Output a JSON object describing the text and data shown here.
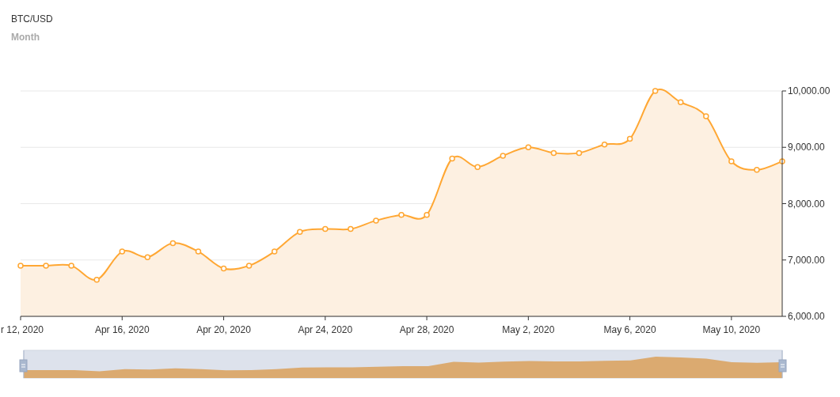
{
  "chart": {
    "subtitle": "Month",
    "chart_data": {
      "type": "area",
      "title": "BTC/USD",
      "grid": true,
      "categories": [
        "r 12, 2020",
        null,
        null,
        null,
        "Apr 16, 2020",
        null,
        null,
        null,
        "Apr 20, 2020",
        null,
        null,
        null,
        "Apr 24, 2020",
        null,
        null,
        null,
        "Apr 28, 2020",
        null,
        null,
        null,
        "May 2, 2020",
        null,
        null,
        null,
        "May 6, 2020",
        null,
        null,
        null,
        "May 10, 2020",
        null,
        null
      ],
      "series": [
        {
          "color": "#ffa733",
          "values": [
            6900,
            6900,
            6900,
            6650,
            7150,
            7050,
            7300,
            7150,
            6850,
            6900,
            7150,
            7500,
            7550,
            7550,
            7700,
            7800,
            7800,
            8800,
            8650,
            8850,
            9000,
            8900,
            8900,
            9050,
            9150,
            10000,
            9800,
            9550,
            8750,
            8600,
            8750
          ]
        }
      ],
      "ylim": [
        6000,
        10000
      ],
      "yticks": [
        {
          "value": 6000,
          "label": "6,000.00"
        },
        {
          "value": 7000,
          "label": "7,000.00"
        },
        {
          "value": 8000,
          "label": "8,000.00"
        },
        {
          "value": 9000,
          "label": "9,000.00"
        },
        {
          "value": 10000,
          "label": "10,000.00"
        }
      ]
    }
  }
}
